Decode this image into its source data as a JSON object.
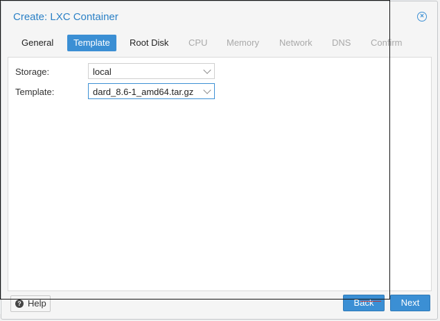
{
  "dialog": {
    "title": "Create: LXC Container",
    "close_icon": "close-icon"
  },
  "tabs": [
    {
      "label": "General",
      "state": "normal"
    },
    {
      "label": "Template",
      "state": "active"
    },
    {
      "label": "Root Disk",
      "state": "normal"
    },
    {
      "label": "CPU",
      "state": "disabled"
    },
    {
      "label": "Memory",
      "state": "disabled"
    },
    {
      "label": "Network",
      "state": "disabled"
    },
    {
      "label": "DNS",
      "state": "disabled"
    },
    {
      "label": "Confirm",
      "state": "disabled"
    }
  ],
  "form": {
    "storage_label": "Storage:",
    "storage_value": "local",
    "template_label": "Template:",
    "template_value": "dard_8.6-1_amd64.tar.gz"
  },
  "footer": {
    "help_label": "Help",
    "help_icon": "question-circle-icon",
    "back_label": "Back",
    "next_label": "Next"
  },
  "colors": {
    "accent": "#3b8fd4",
    "title": "#2a80c6",
    "disabled_text": "#a9a9a9"
  }
}
